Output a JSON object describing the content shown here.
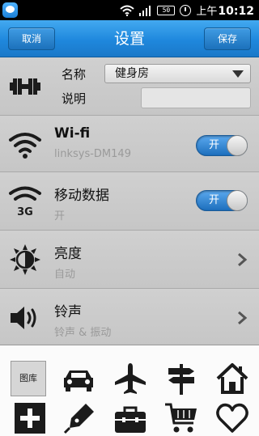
{
  "status_bar": {
    "battery": "50",
    "ampm": "上午",
    "time": "10:12"
  },
  "header": {
    "title": "设置",
    "cancel_label": "取消",
    "save_label": "保存"
  },
  "profile": {
    "name_label": "名称",
    "name_value": "健身房",
    "desc_label": "说明",
    "desc_value": ""
  },
  "settings": [
    {
      "title": "Wi-fi",
      "subtitle": "linksys-DM149",
      "control": "toggle",
      "toggle_label": "开",
      "on": true,
      "icon": "wifi-icon"
    },
    {
      "title": "移动数据",
      "subtitle": "开",
      "control": "toggle",
      "toggle_label": "开",
      "on": true,
      "icon": "mobile-data-3g-icon",
      "icon_text": "3G"
    },
    {
      "title": "亮度",
      "subtitle": "自动",
      "control": "chevron",
      "icon": "brightness-icon"
    },
    {
      "title": "铃声",
      "subtitle": "铃声 & 振动",
      "control": "chevron",
      "icon": "speaker-icon"
    }
  ],
  "icon_grid": {
    "library_label": "图库",
    "icons": [
      "car-icon",
      "airplane-icon",
      "signpost-icon",
      "home-icon",
      "plus-icon",
      "pen-icon",
      "toolbox-icon",
      "shopping-cart-icon",
      "heart-icon"
    ]
  },
  "colors": {
    "header_blue": "#1f88dd",
    "toggle_blue": "#1d6fbd",
    "list_bg": "#c9c9c9"
  }
}
